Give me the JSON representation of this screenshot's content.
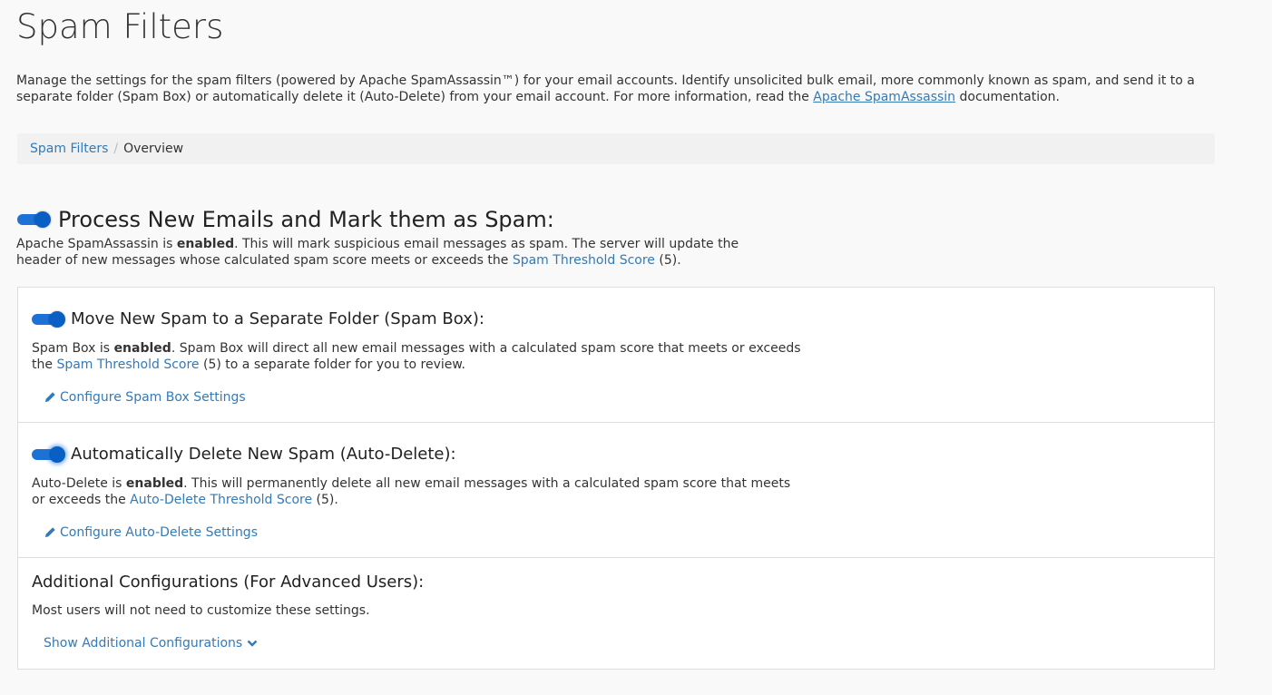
{
  "page": {
    "title": "Spam Filters",
    "intro_before": "Manage the settings for the spam filters (powered by Apache SpamAssassin™) for your email accounts. Identify unsolicited bulk email, more commonly known as spam, and send it to a separate folder (Spam Box) or automatically delete it (Auto-Delete) from your email account. For more information, read the ",
    "intro_link": "Apache SpamAssassin",
    "intro_after": " documentation."
  },
  "breadcrumb": {
    "parent": "Spam Filters",
    "separator": "/",
    "current": "Overview"
  },
  "process": {
    "heading": "Process New Emails and Mark them as Spam:",
    "toggle_on": true,
    "desc_before": "Apache SpamAssassin is ",
    "desc_bold": "enabled",
    "desc_middle": ". This will mark suspicious email messages as spam. The server will update the header of new messages whose calculated spam score meets or exceeds the ",
    "desc_link": "Spam Threshold Score",
    "desc_after": " (5)."
  },
  "spam_box": {
    "heading": "Move New Spam to a Separate Folder (Spam Box):",
    "toggle_on": true,
    "desc_before": "Spam Box is ",
    "desc_bold": "enabled",
    "desc_middle": ". Spam Box will direct all new email messages with a calculated spam score that meets or exceeds the ",
    "desc_link": "Spam Threshold Score",
    "desc_after": " (5) to a separate folder for you to review.",
    "configure_link": "Configure Spam Box Settings",
    "configure_icon": "pencil-icon"
  },
  "auto_delete": {
    "heading": "Automatically Delete New Spam (Auto-Delete):",
    "toggle_on": true,
    "desc_before": "Auto-Delete is ",
    "desc_bold": "enabled",
    "desc_middle": ". This will permanently delete all new email messages with a calculated spam score that meets or exceeds the ",
    "desc_link": "Auto-Delete Threshold Score",
    "desc_after": " (5).",
    "configure_link": "Configure Auto-Delete Settings",
    "configure_icon": "pencil-icon"
  },
  "additional": {
    "heading": "Additional Configurations (For Advanced Users):",
    "desc": "Most users will not need to customize these settings.",
    "show_link": "Show Additional Configurations",
    "show_icon": "chevron-down-icon"
  },
  "colors": {
    "link": "#337ab7",
    "toggle_on": "#1e72d6",
    "background": "#f9f9f9",
    "panel_border": "#dddddd"
  }
}
